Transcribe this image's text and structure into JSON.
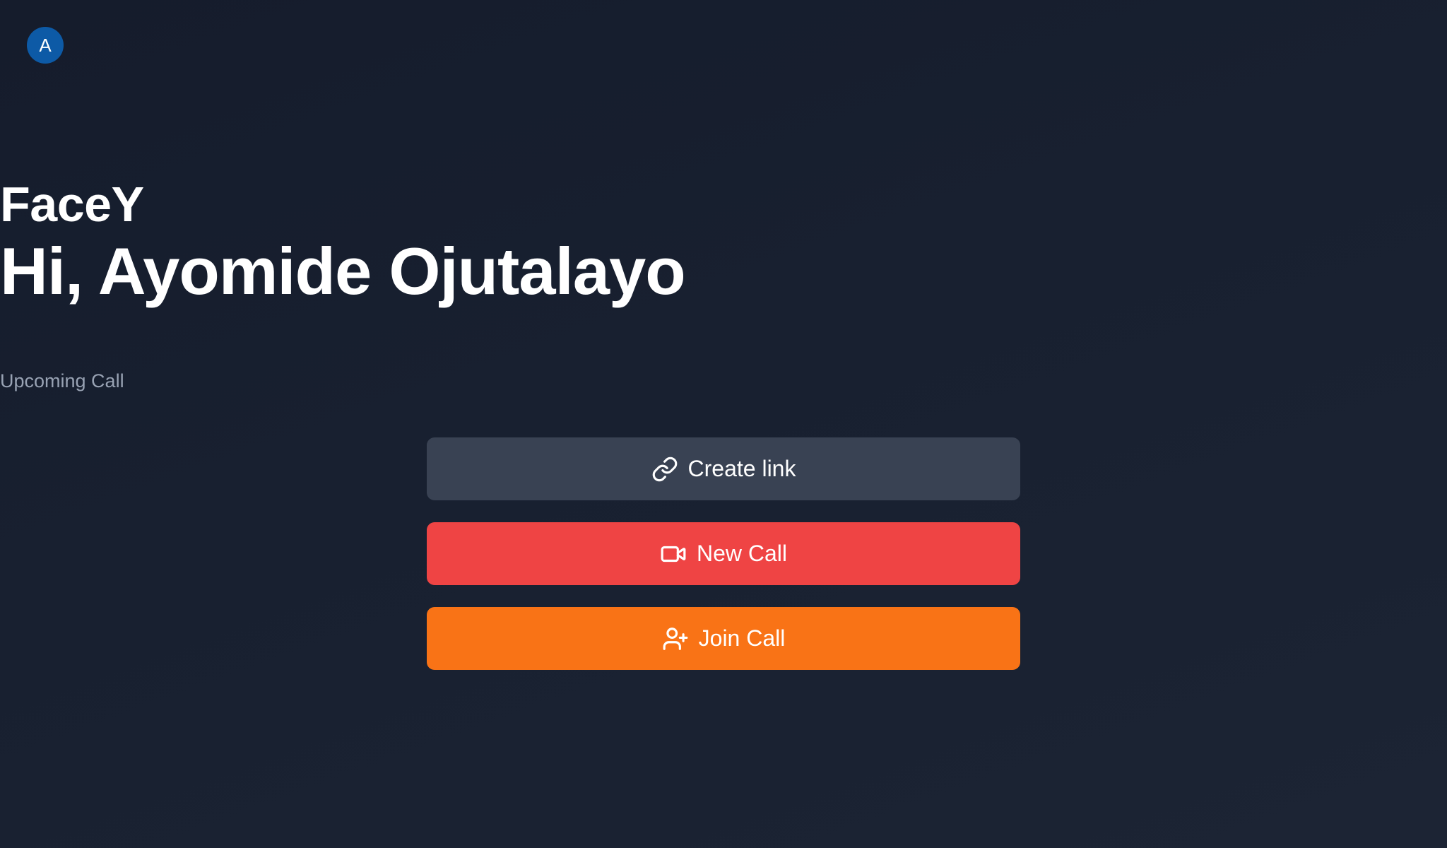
{
  "user": {
    "avatar_initial": "A"
  },
  "hero": {
    "app_title": "FaceY",
    "greeting": "Hi, Ayomide Ojutalayo",
    "subtitle": "Upcoming Call"
  },
  "actions": {
    "create_link": {
      "label": "Create link",
      "icon": "link-icon",
      "color": "#394253"
    },
    "new_call": {
      "label": "New Call",
      "icon": "video-camera-icon",
      "color": "#ef4444"
    },
    "join_call": {
      "label": "Join Call",
      "icon": "user-plus-icon",
      "color": "#f97316"
    }
  },
  "colors": {
    "background": "#182030",
    "avatar": "#0d5aa6",
    "subtitle_text": "#98a2b3"
  }
}
